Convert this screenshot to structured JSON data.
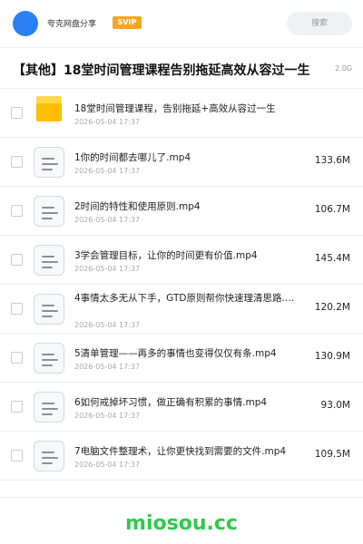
{
  "header": {
    "app_name": "夸克网盘分享",
    "badge": "SVIP",
    "search_placeholder": "搜索"
  },
  "share": {
    "title": "【其他】18堂时间管理课程告别拖延高效从容过一生",
    "total_size": "2.0G"
  },
  "files": [
    {
      "type": "folder",
      "name": "18堂时间管理课程，告别拖延+高效从容过一生",
      "date": "2026-05-04 17:37",
      "size": ""
    },
    {
      "type": "file",
      "name": "1你的时间都去哪儿了.mp4",
      "date": "2026-05-04 17:37",
      "size": "133.6M"
    },
    {
      "type": "file",
      "name": "2时间的特性和使用原则.mp4",
      "date": "2026-05-04 17:37",
      "size": "106.7M"
    },
    {
      "type": "file",
      "name": "3学会管理目标，让你的时间更有价值.mp4",
      "date": "2026-05-04 17:37",
      "size": "145.4M"
    },
    {
      "type": "file",
      "name": "4事情太多无从下手，GTD原则帮你快速理清思路.…",
      "date": "2026-05-04 17:37",
      "size": "120.2M"
    },
    {
      "type": "file",
      "name": "5清单管理——再多的事情也变得仅仅有条.mp4",
      "date": "2026-05-04 17:37",
      "size": "130.9M"
    },
    {
      "type": "file",
      "name": "6如何戒掉坏习惯，做正确有积累的事情.mp4",
      "date": "2026-05-04 17:37",
      "size": "93.0M"
    },
    {
      "type": "file",
      "name": "7电脑文件整理术，让你更快找到需要的文件.mp4",
      "date": "2026-05-04 17:37",
      "size": "109.5M"
    }
  ],
  "footer": {
    "brand": "miosou.cc"
  },
  "colors": {
    "avatar": "#2a7ff5",
    "badge": "#f5a623",
    "folder": "#ffbf00",
    "brand": "#31c94a"
  },
  "icons": {
    "folder": "folder-icon",
    "file": "video-file-icon"
  }
}
